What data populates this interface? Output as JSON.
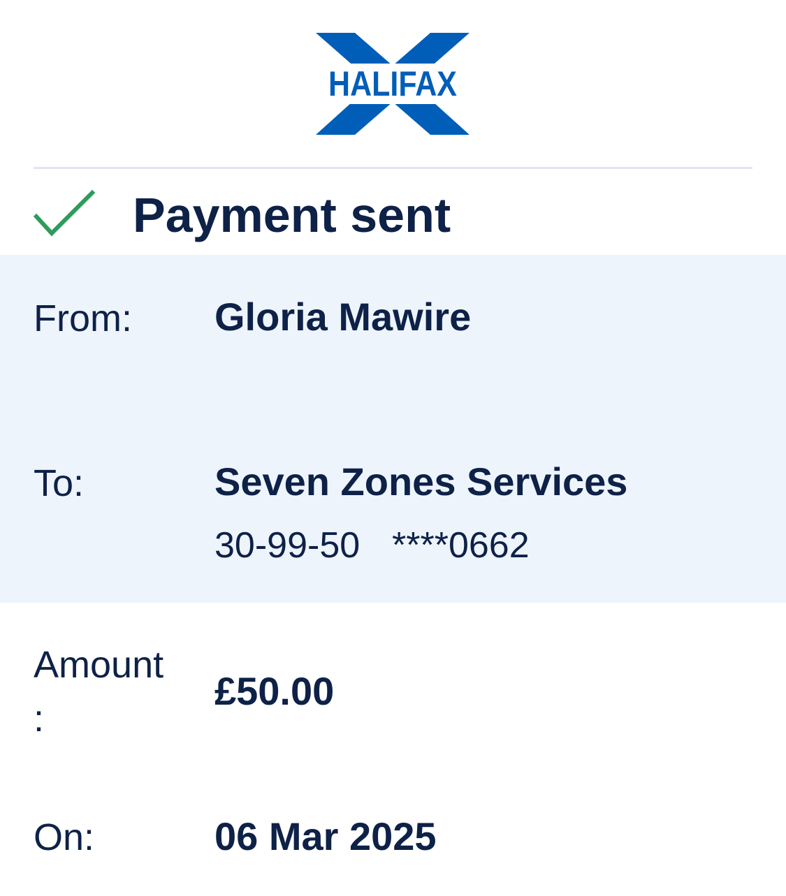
{
  "brand": {
    "name": "HALIFAX",
    "logo_color": "#005eb8"
  },
  "status": {
    "icon": "check-icon",
    "icon_color": "#2e9b5c",
    "title": "Payment sent"
  },
  "details": {
    "from": {
      "label": "From:",
      "value": "Gloria Mawire"
    },
    "to": {
      "label": "To:",
      "value": "Seven Zones Services",
      "sort_code": "30-99-50",
      "account": "****0662"
    },
    "amount": {
      "label_line1": "Amount",
      "label_line2": ":",
      "value": "£50.00"
    },
    "on": {
      "label": "On:",
      "value": "06 Mar 2025"
    }
  },
  "colors": {
    "text": "#0e2147",
    "shaded_bg": "#edf4fc",
    "divider": "#e3e5ee"
  }
}
